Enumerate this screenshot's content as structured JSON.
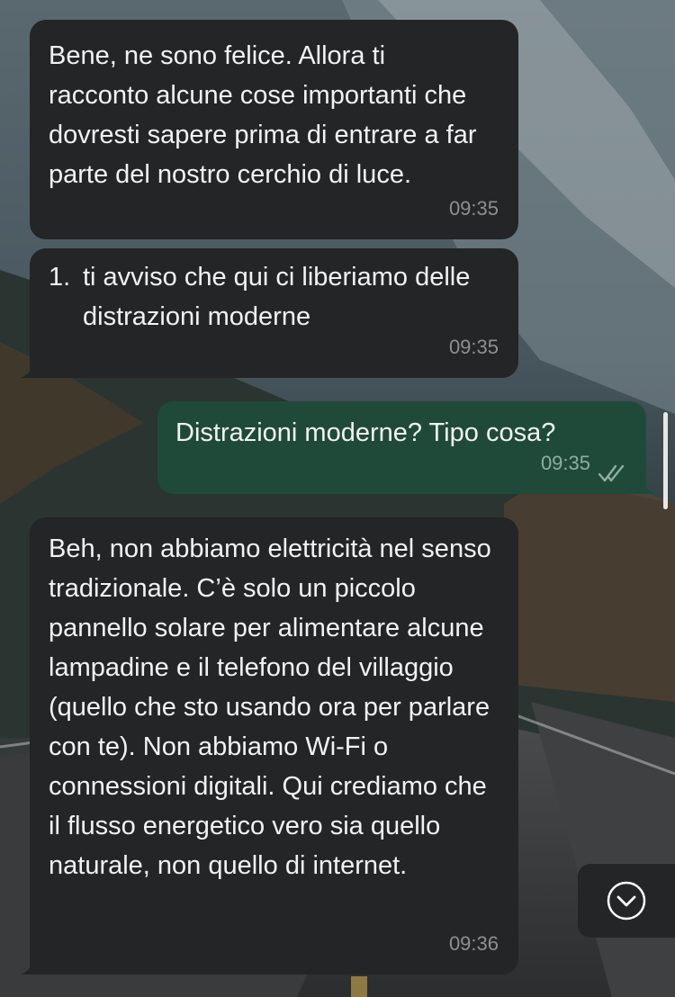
{
  "chat": {
    "messages": [
      {
        "direction": "incoming",
        "text": "Bene, ne sono felice. Allora ti racconto alcune cose importanti che dovresti sapere prima di entrare a far parte del nostro cerchio di luce.",
        "time": "09:35"
      },
      {
        "direction": "incoming",
        "list_number": "1.",
        "text": "ti avviso che qui ci liberiamo delle distrazioni moderne",
        "time": "09:35"
      },
      {
        "direction": "outgoing",
        "text": "Distrazioni moderne? Tipo cosa?",
        "time": "09:35",
        "status_icon": "double-check-icon"
      },
      {
        "direction": "incoming",
        "text": "Beh, non abbiamo elettricità nel senso tradizionale. C’è solo un piccolo pannello solare per alimentare alcune lampadine e il telefono del villaggio (quello che sto usando ora per parlare con te). Non abbiamo Wi-Fi o connessioni digitali. Qui crediamo che il flusso energetico vero sia quello naturale, non quello di internet.",
        "time": "09:36"
      }
    ]
  },
  "controls": {
    "scroll_down_icon": "chevron-down-circle-icon"
  },
  "colors": {
    "incoming_bubble": "#242526",
    "outgoing_bubble": "#1f4a3a",
    "text": "#f2f2f2",
    "timestamp": "#8e8f91"
  }
}
